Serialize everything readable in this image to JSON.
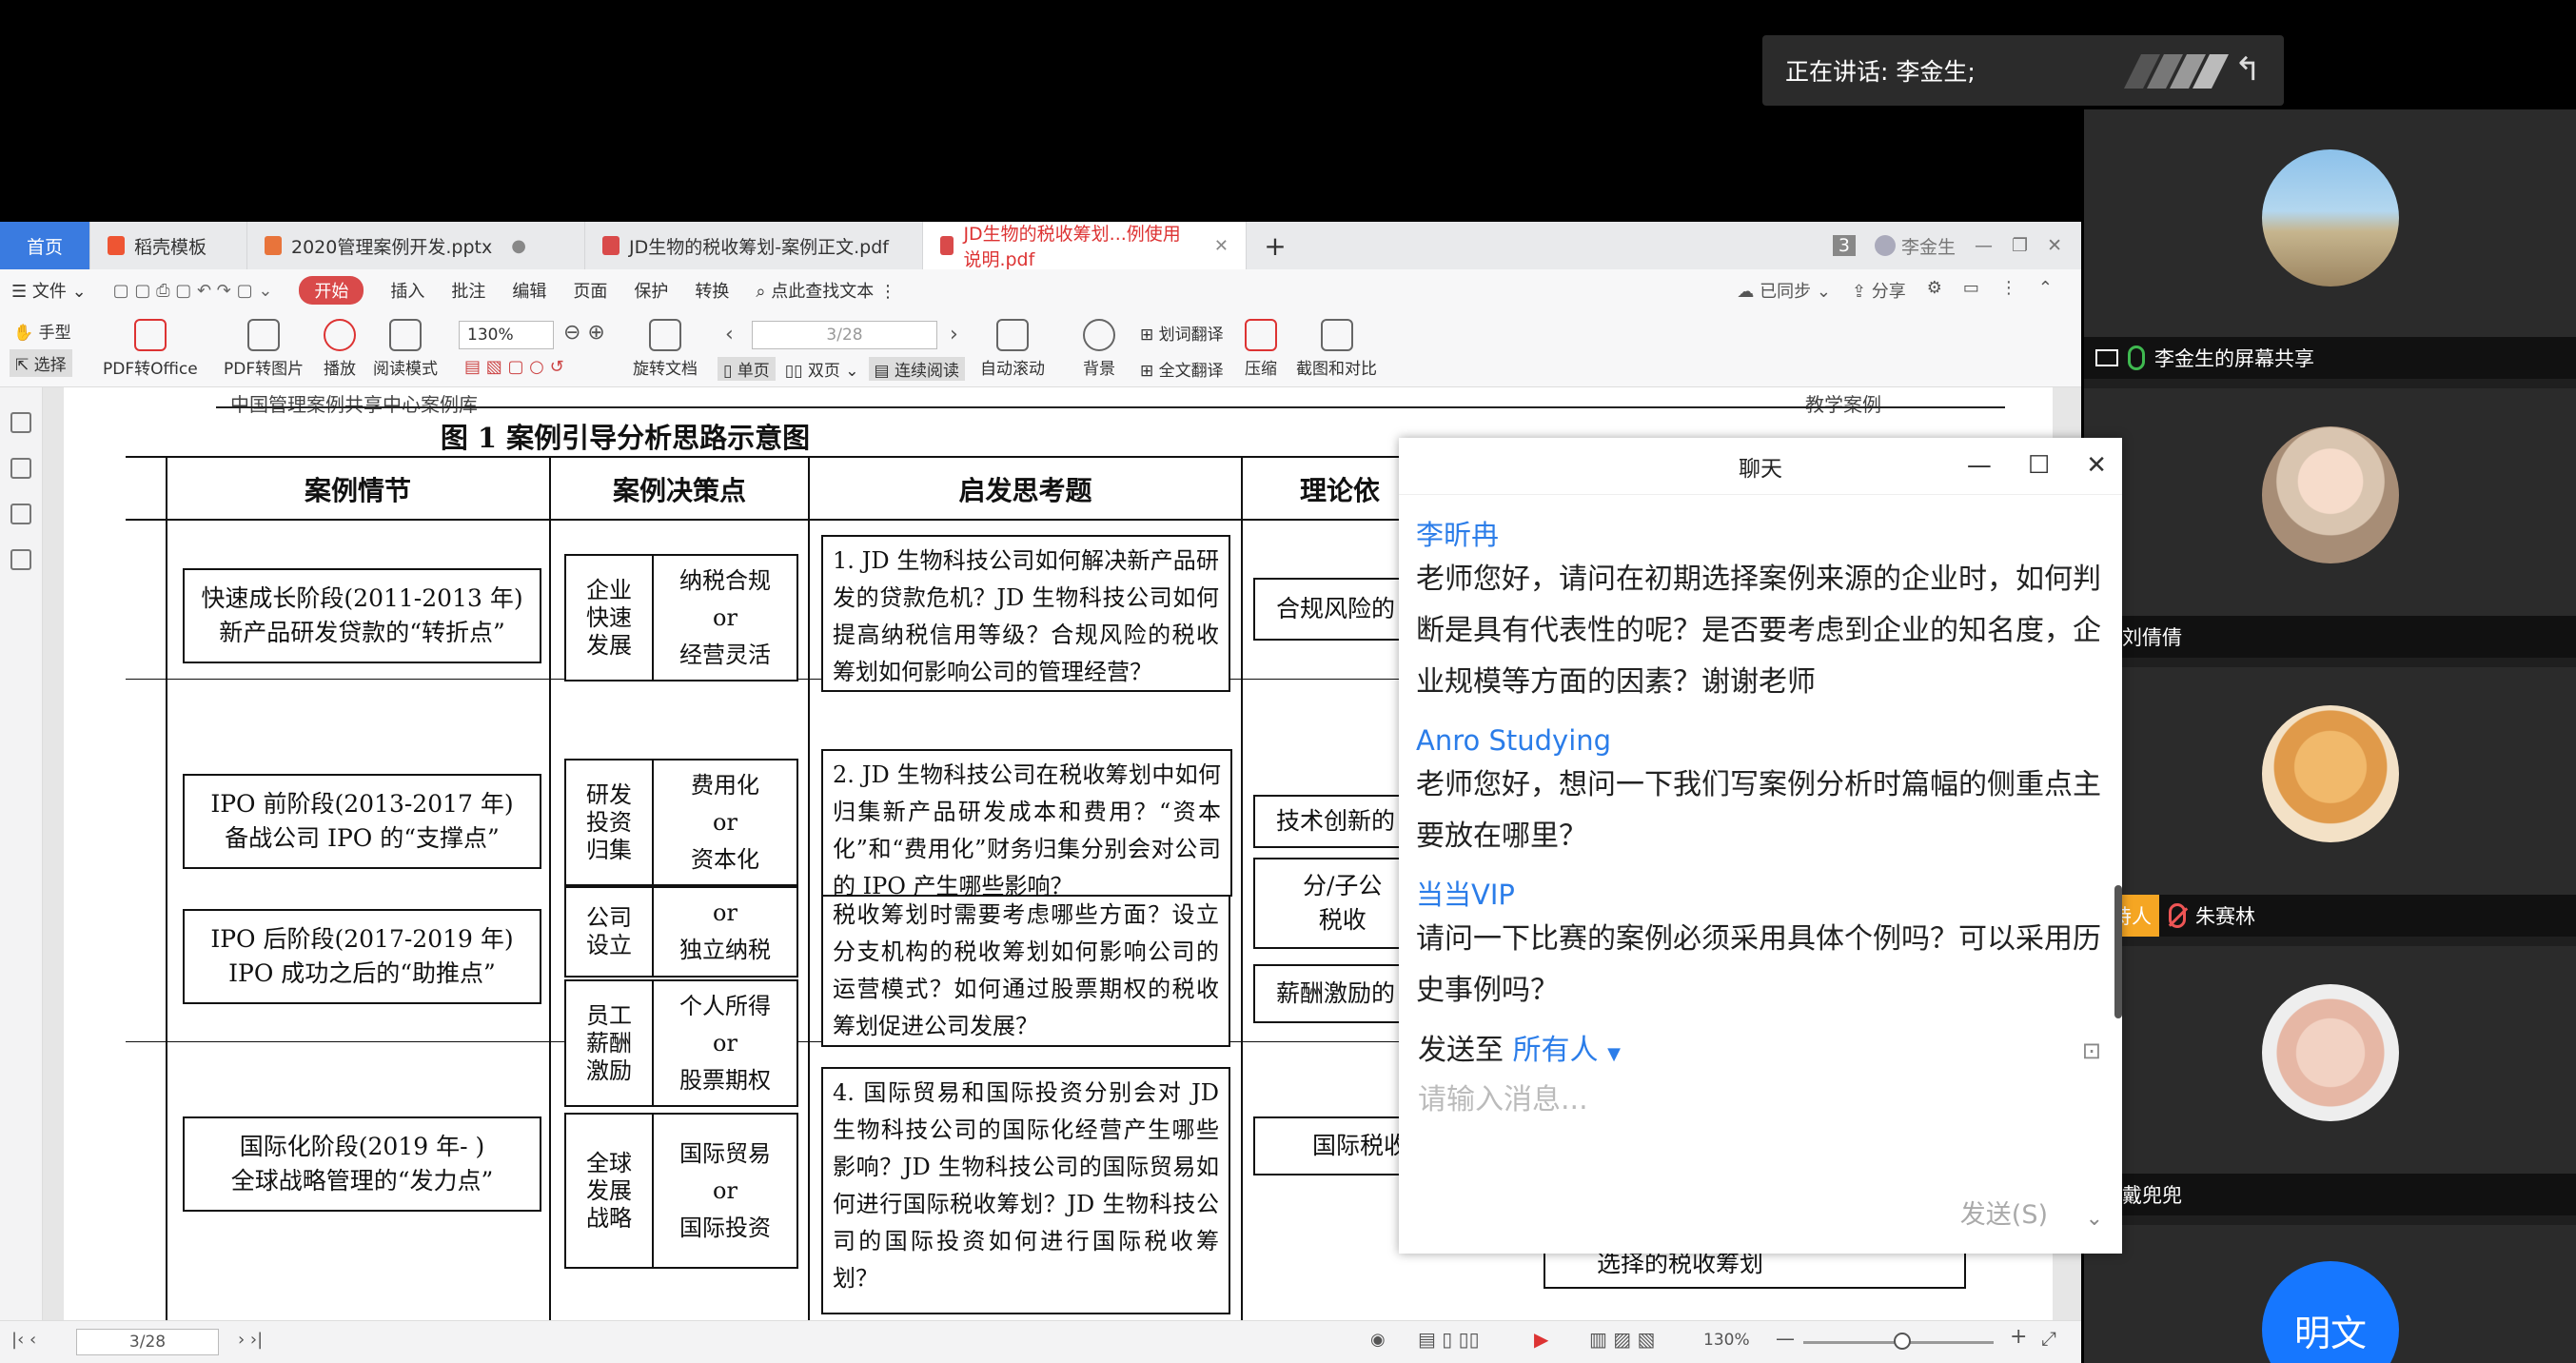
{
  "speaking": {
    "label": "正在讲话: 李金生;"
  },
  "participants": [
    {
      "name": "李金生的屏幕共享",
      "type": "screen"
    },
    {
      "name": "刘倩倩"
    },
    {
      "name": "朱赛林",
      "badge": "主持人"
    },
    {
      "name": "戴兜兜"
    },
    {
      "avatar_text": "明文"
    }
  ],
  "wps": {
    "tabs": [
      {
        "label": "首页"
      },
      {
        "label": "稻壳模板"
      },
      {
        "label": "2020管理案例开发.pptx"
      },
      {
        "label": "JD生物的税收筹划-案例正文.pdf"
      },
      {
        "label": "JD生物的税收筹划...例使用说明.pdf"
      }
    ],
    "tab_badge": "3",
    "user": "李金生",
    "menu": {
      "file": "文件",
      "start": "开始",
      "items": [
        "插入",
        "批注",
        "编辑",
        "页面",
        "保护",
        "转换"
      ],
      "search": "点此查找文本",
      "sync": "已同步",
      "share": "分享"
    },
    "toolbar": {
      "hand": "手型",
      "select": "选择",
      "pdf_office": "PDF转Office",
      "pdf_image": "PDF转图片",
      "play": "播放",
      "read_mode": "阅读模式",
      "zoom": "130%",
      "rotate": "旋转文档",
      "page": "3/28",
      "single": "单页",
      "double": "双页",
      "continuous": "连续阅读",
      "autoscroll": "自动滚动",
      "background": "背景",
      "word_translate": "划词翻译",
      "full_translate": "全文翻译",
      "compress": "压缩",
      "screenshot": "截图和对比"
    },
    "status": {
      "page": "3/28",
      "zoom": "130%"
    }
  },
  "doc": {
    "header_left": "中国管理案例共享中心案例库",
    "header_right": "教学案例",
    "fig_title": "图 1  案例引导分析思路示意图",
    "col_heads": [
      "案例情节",
      "案例决策点",
      "启发思考题",
      "理论依"
    ],
    "plots": [
      "快速成长阶段(2011-2013 年)<br>新产品研发贷款的“转折点”",
      "IPO 前阶段(2013-2017 年)<br>备战公司 IPO 的“支撑点”",
      "IPO 后阶段(2017-2019 年)<br>IPO 成功之后的“助推点”",
      "国际化阶段(2019 年- )<br>全球战略管理的“发力点”"
    ],
    "decisions": [
      {
        "l": "企业<br>快速<br>发展",
        "r": "纳税合规<br>or<br>经营灵活"
      },
      {
        "l": "研发<br>投资<br>归集",
        "r": "费用化<br>or<br>资本化"
      },
      {
        "l": "公司<br>设立",
        "r": "or<br>独立纳税"
      },
      {
        "l": "员工<br>薪酬<br>激励",
        "r": "个人所得<br>or<br>股票期权"
      },
      {
        "l": "全球<br>发展<br>战略",
        "r": "国际贸易<br>or<br>国际投资"
      }
    ],
    "questions": [
      "1. JD 生物科技公司如何解决新产品研发的贷款危机？JD 生物科技公司如何提高纳税信用等级？合规风险的税收筹划如何影响公司的管理经营？",
      "2. JD 生物科技公司在税收筹划中如何归集新产品研发成本和费用？“资本化”和“费用化”财务归集分别会对公司的 IPO 产生哪些影响？",
      "税收筹划时需要考虑哪些方面？设立分支机构的税收筹划如何影响公司的运营模式？如何通过股票期权的税收筹划促进公司发展？",
      "4. 国际贸易和国际投资分别会对 JD 生物科技公司的国际化经营产生哪些影响？JD 生物科技公司的国际贸易如何进行国际税收筹划？JD 生物科技公司的国际投资如何进行国际税收筹划？"
    ],
    "theories": [
      "合规风险的",
      "技术创新的",
      "分/子公<br>税收",
      "薪酬激励的",
      "国际税收"
    ],
    "last_theory": "选择的税收筹划"
  },
  "chat": {
    "title": "聊天",
    "messages": [
      {
        "sender": "李昕冉",
        "text": "老师您好，请问在初期选择案例来源的企业时，如何判断是具有代表性的呢？是否要考虑到企业的知名度，企业规模等方面的因素？谢谢老师"
      },
      {
        "sender": "Anro   Studying",
        "text": "老师您好，想问一下我们写案例分析时篇幅的侧重点主要放在哪里？"
      },
      {
        "sender": "当当VIP",
        "text": "请问一下比赛的案例必须采用具体个例吗？可以采用历史事例吗？"
      }
    ],
    "send_to_label": "发送至",
    "send_to_value": "所有人",
    "placeholder": "请输入消息...",
    "send_button": "发送(S)"
  },
  "colors": {
    "accent": "#2b7de9",
    "wps_red": "#d94a4a",
    "host": "#f5a623"
  }
}
